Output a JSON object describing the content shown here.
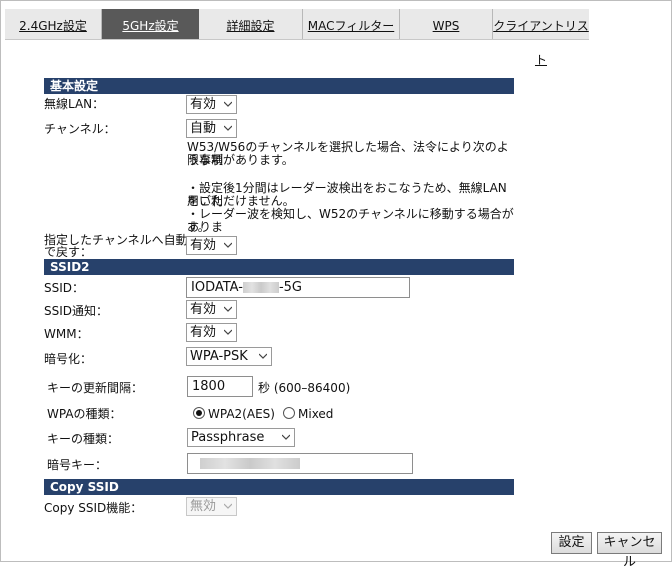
{
  "tabs": [
    {
      "label": "2.4GHz設定"
    },
    {
      "label": "5GHz設定"
    },
    {
      "label": "詳細設定"
    },
    {
      "label": "MACフィルター"
    },
    {
      "label": "WPS"
    },
    {
      "label": "クライアントリスト"
    }
  ],
  "basic": {
    "header": "基本設定",
    "wireless_lan_label": "無線LAN：",
    "wireless_lan_value": "有効",
    "channel_label": "チャンネル：",
    "channel_value": "自動",
    "notes": [
      "W53/W56のチャンネルを選択した場合、法令により次のような制",
      "限事項があります。",
      "・設定後1分間はレーダー波検出をおこなうため、無線LANをご利",
      "用いただけません。",
      "・レーダー波を検知し、W52のチャンネルに移動する場合がありま",
      "す。"
    ],
    "auto_return_label_1": "指定したチャンネルへ自動",
    "auto_return_label_2": "で戻す：",
    "auto_return_value": "有効"
  },
  "ssid2": {
    "header": "SSID2",
    "ssid_label": "SSID：",
    "ssid_prefix": "IODATA-",
    "ssid_suffix": "-5G",
    "ssid_broadcast_label": "SSID通知：",
    "ssid_broadcast_value": "有効",
    "wmm_label": "WMM：",
    "wmm_value": "有効",
    "encryption_label": "暗号化：",
    "encryption_value": "WPA-PSK",
    "key_interval_label": "キーの更新間隔：",
    "key_interval_value": "1800",
    "key_interval_unit": "秒 (600–86400)",
    "wpa_type_label": "WPAの種類：",
    "wpa_option_1": "WPA2(AES)",
    "wpa_option_2": "Mixed",
    "key_type_label": "キーの種類：",
    "key_type_value": "Passphrase",
    "encryption_key_label": "暗号キー："
  },
  "copy_ssid": {
    "header": "Copy SSID",
    "label": "Copy SSID機能：",
    "value": "無効"
  },
  "buttons": {
    "apply": "設定",
    "cancel": "キャンセル"
  }
}
